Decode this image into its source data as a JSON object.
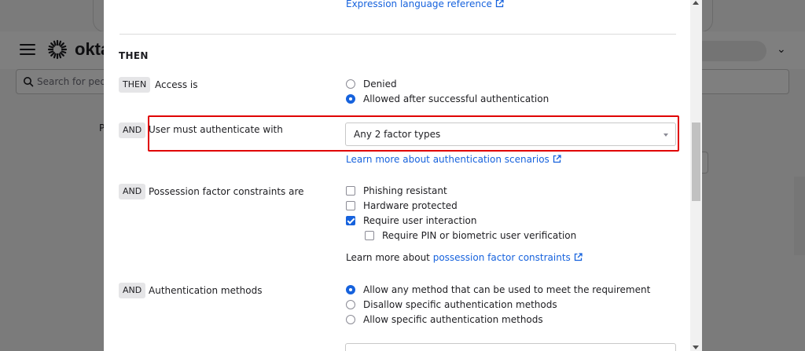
{
  "background": {
    "logo_text": "okta",
    "search_placeholder": "Search for peop",
    "tab_letter": "P"
  },
  "modal": {
    "expression_link": "Expression language reference",
    "section_title": "THEN",
    "rows": {
      "access": {
        "tag": "THEN",
        "label": "Access is",
        "options": [
          "Denied",
          "Allowed after successful authentication"
        ],
        "selected": "Allowed after successful authentication"
      },
      "authenticate": {
        "tag": "AND",
        "label": "User must authenticate with",
        "select_value": "Any 2 factor types",
        "learn_more_link": "Learn more about authentication scenarios"
      },
      "possession": {
        "tag": "AND",
        "label": "Possession factor constraints are",
        "options": [
          "Phishing resistant",
          "Hardware protected",
          "Require user interaction"
        ],
        "checked": [
          "Require user interaction"
        ],
        "sub_option": "Require PIN or biometric user verification",
        "learn_more_prefix": "Learn more about",
        "learn_more_link": "possession factor constraints"
      },
      "methods": {
        "tag": "AND",
        "label": "Authentication methods",
        "options": [
          "Allow any method that can be used to meet the requirement",
          "Disallow specific authentication methods",
          "Allow specific authentication methods"
        ],
        "selected": "Allow any method that can be used to meet the requirement"
      }
    }
  },
  "colors": {
    "link": "#1662dd",
    "highlight": "#e00000",
    "tag_bg": "#e5e5e7"
  }
}
